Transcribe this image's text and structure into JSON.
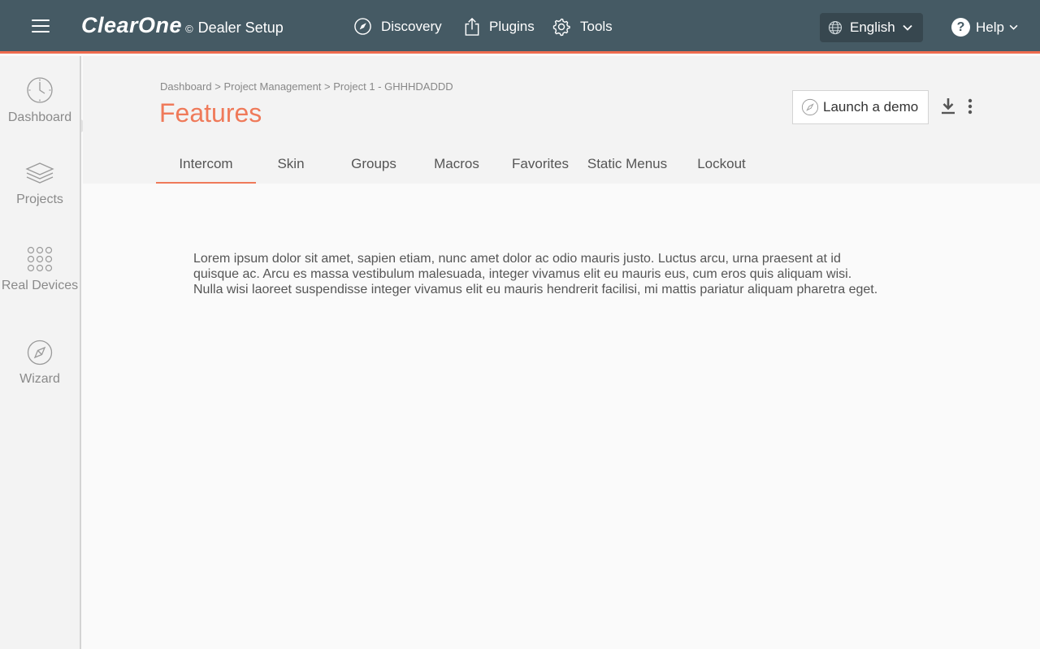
{
  "header": {
    "brand": "ClearOne",
    "brand_copyright": "©",
    "brand_subtitle": "Dealer Setup",
    "nav": [
      {
        "label": "Discovery",
        "icon": "compass-arrow-icon"
      },
      {
        "label": "Plugins",
        "icon": "upload-icon"
      },
      {
        "label": "Tools",
        "icon": "gear-icon"
      }
    ],
    "language": {
      "selected": "English",
      "icon": "globe-icon"
    },
    "help": {
      "label": "Help",
      "icon": "question-circle-icon"
    }
  },
  "sidebar": {
    "items": [
      {
        "label": "Dashboard",
        "icon": "clock-icon"
      },
      {
        "label": "Projects",
        "icon": "layers-icon"
      },
      {
        "label": "Real Devices",
        "icon": "grid-dots-icon"
      },
      {
        "label": "Wizard",
        "icon": "compass-icon"
      }
    ],
    "active": "Projects"
  },
  "page": {
    "breadcrumb": [
      "Dashboard",
      "Project Management",
      "Project 1 - GHHHDADDD"
    ],
    "breadcrumb_separator": ">",
    "title": "Features",
    "launch_demo_label": "Launch a demo",
    "tabs": [
      {
        "label": "Intercom",
        "active": true
      },
      {
        "label": "Skin",
        "active": false
      },
      {
        "label": "Groups",
        "active": false
      },
      {
        "label": "Macros",
        "active": false
      },
      {
        "label": "Favorites",
        "active": false
      },
      {
        "label": "Static Menus",
        "active": false
      },
      {
        "label": "Lockout",
        "active": false
      }
    ],
    "body_text": "Lorem ipsum dolor sit amet, sapien etiam, nunc amet dolor ac odio mauris justo. Luctus arcu, urna praesent at id quisque ac. Arcu es massa vestibulum malesuada, integer vivamus elit eu mauris eus, cum eros quis aliquam wisi. Nulla wisi laoreet suspendisse integer vivamus elit eu mauris hendrerit facilisi, mi mattis pariatur aliquam pharetra eget."
  },
  "colors": {
    "topbar": "#455a64",
    "accent": "#ef7a5a",
    "sidebar_bg": "#f3f3f3",
    "content_bg": "#fafafa"
  }
}
